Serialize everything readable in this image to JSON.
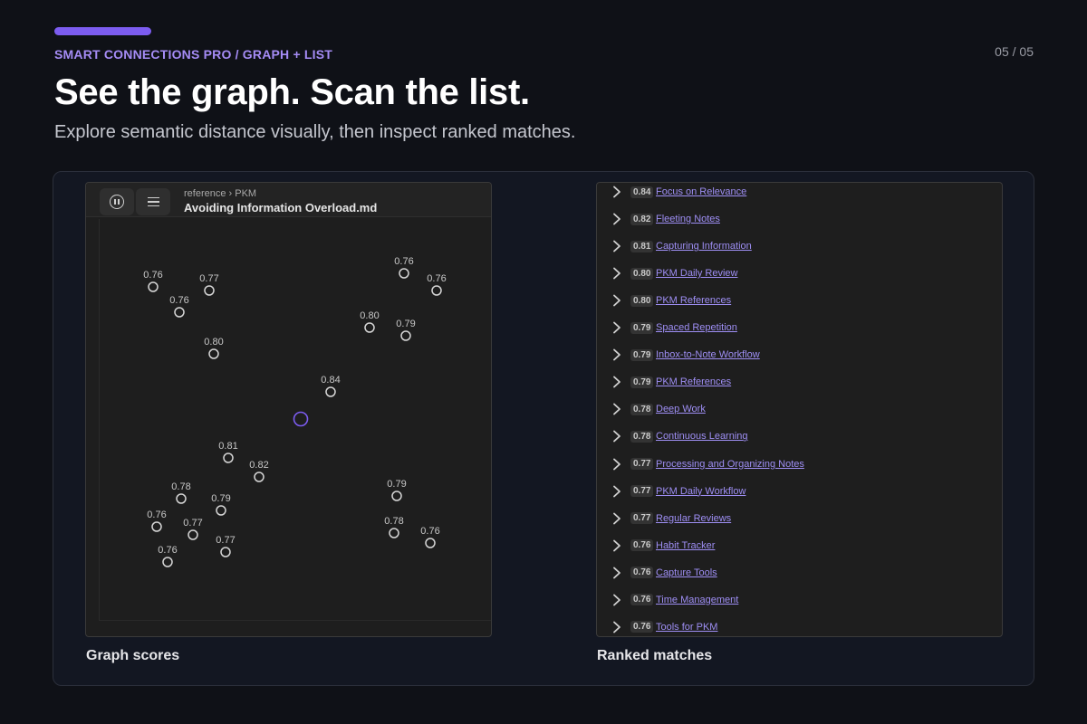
{
  "header": {
    "eyebrow": "SMART CONNECTIONS PRO / GRAPH + LIST",
    "page_count": "05 / 05",
    "title": "See the graph. Scan the list.",
    "subtitle": "Explore semantic distance visually, then inspect ranked matches."
  },
  "colors": {
    "accent": "#7c5cf0",
    "eyebrow": "#a58cf5",
    "link": "#9f8ff5",
    "center_node": "#7c5cf0"
  },
  "graph_panel": {
    "breadcrumb": "reference › PKM",
    "note_title": "Avoiding Information Overload.md",
    "pause_icon": "pause-circle-icon",
    "menu_icon": "hamburger-menu-icon",
    "caption": "Graph scores",
    "nodes": [
      {
        "score": "0.76"
      },
      {
        "score": "0.77"
      },
      {
        "score": "0.76"
      },
      {
        "score": "0.80"
      },
      {
        "score": "0.76"
      },
      {
        "score": "0.76"
      },
      {
        "score": "0.80"
      },
      {
        "score": "0.79"
      },
      {
        "score": "0.84"
      },
      {
        "score": "0.81"
      },
      {
        "score": "0.82"
      },
      {
        "score": "0.78"
      },
      {
        "score": "0.79"
      },
      {
        "score": "0.76"
      },
      {
        "score": "0.77"
      },
      {
        "score": "0.77"
      },
      {
        "score": "0.76"
      },
      {
        "score": "0.79"
      },
      {
        "score": "0.78"
      },
      {
        "score": "0.76"
      }
    ]
  },
  "list_panel": {
    "caption": "Ranked matches",
    "items": [
      {
        "score": "0.84",
        "label": "Focus on Relevance"
      },
      {
        "score": "0.82",
        "label": "Fleeting Notes"
      },
      {
        "score": "0.81",
        "label": "Capturing Information"
      },
      {
        "score": "0.80",
        "label": "PKM Daily Review"
      },
      {
        "score": "0.80",
        "label": "PKM References"
      },
      {
        "score": "0.79",
        "label": "Spaced Repetition"
      },
      {
        "score": "0.79",
        "label": "Inbox-to-Note Workflow"
      },
      {
        "score": "0.79",
        "label": "PKM References"
      },
      {
        "score": "0.78",
        "label": "Deep Work"
      },
      {
        "score": "0.78",
        "label": "Continuous Learning"
      },
      {
        "score": "0.77",
        "label": "Processing and Organizing Notes"
      },
      {
        "score": "0.77",
        "label": "PKM Daily Workflow"
      },
      {
        "score": "0.77",
        "label": "Regular Reviews"
      },
      {
        "score": "0.76",
        "label": "Habit Tracker"
      },
      {
        "score": "0.76",
        "label": "Capture Tools"
      },
      {
        "score": "0.76",
        "label": "Time Management"
      },
      {
        "score": "0.76",
        "label": "Tools for PKM"
      }
    ]
  }
}
